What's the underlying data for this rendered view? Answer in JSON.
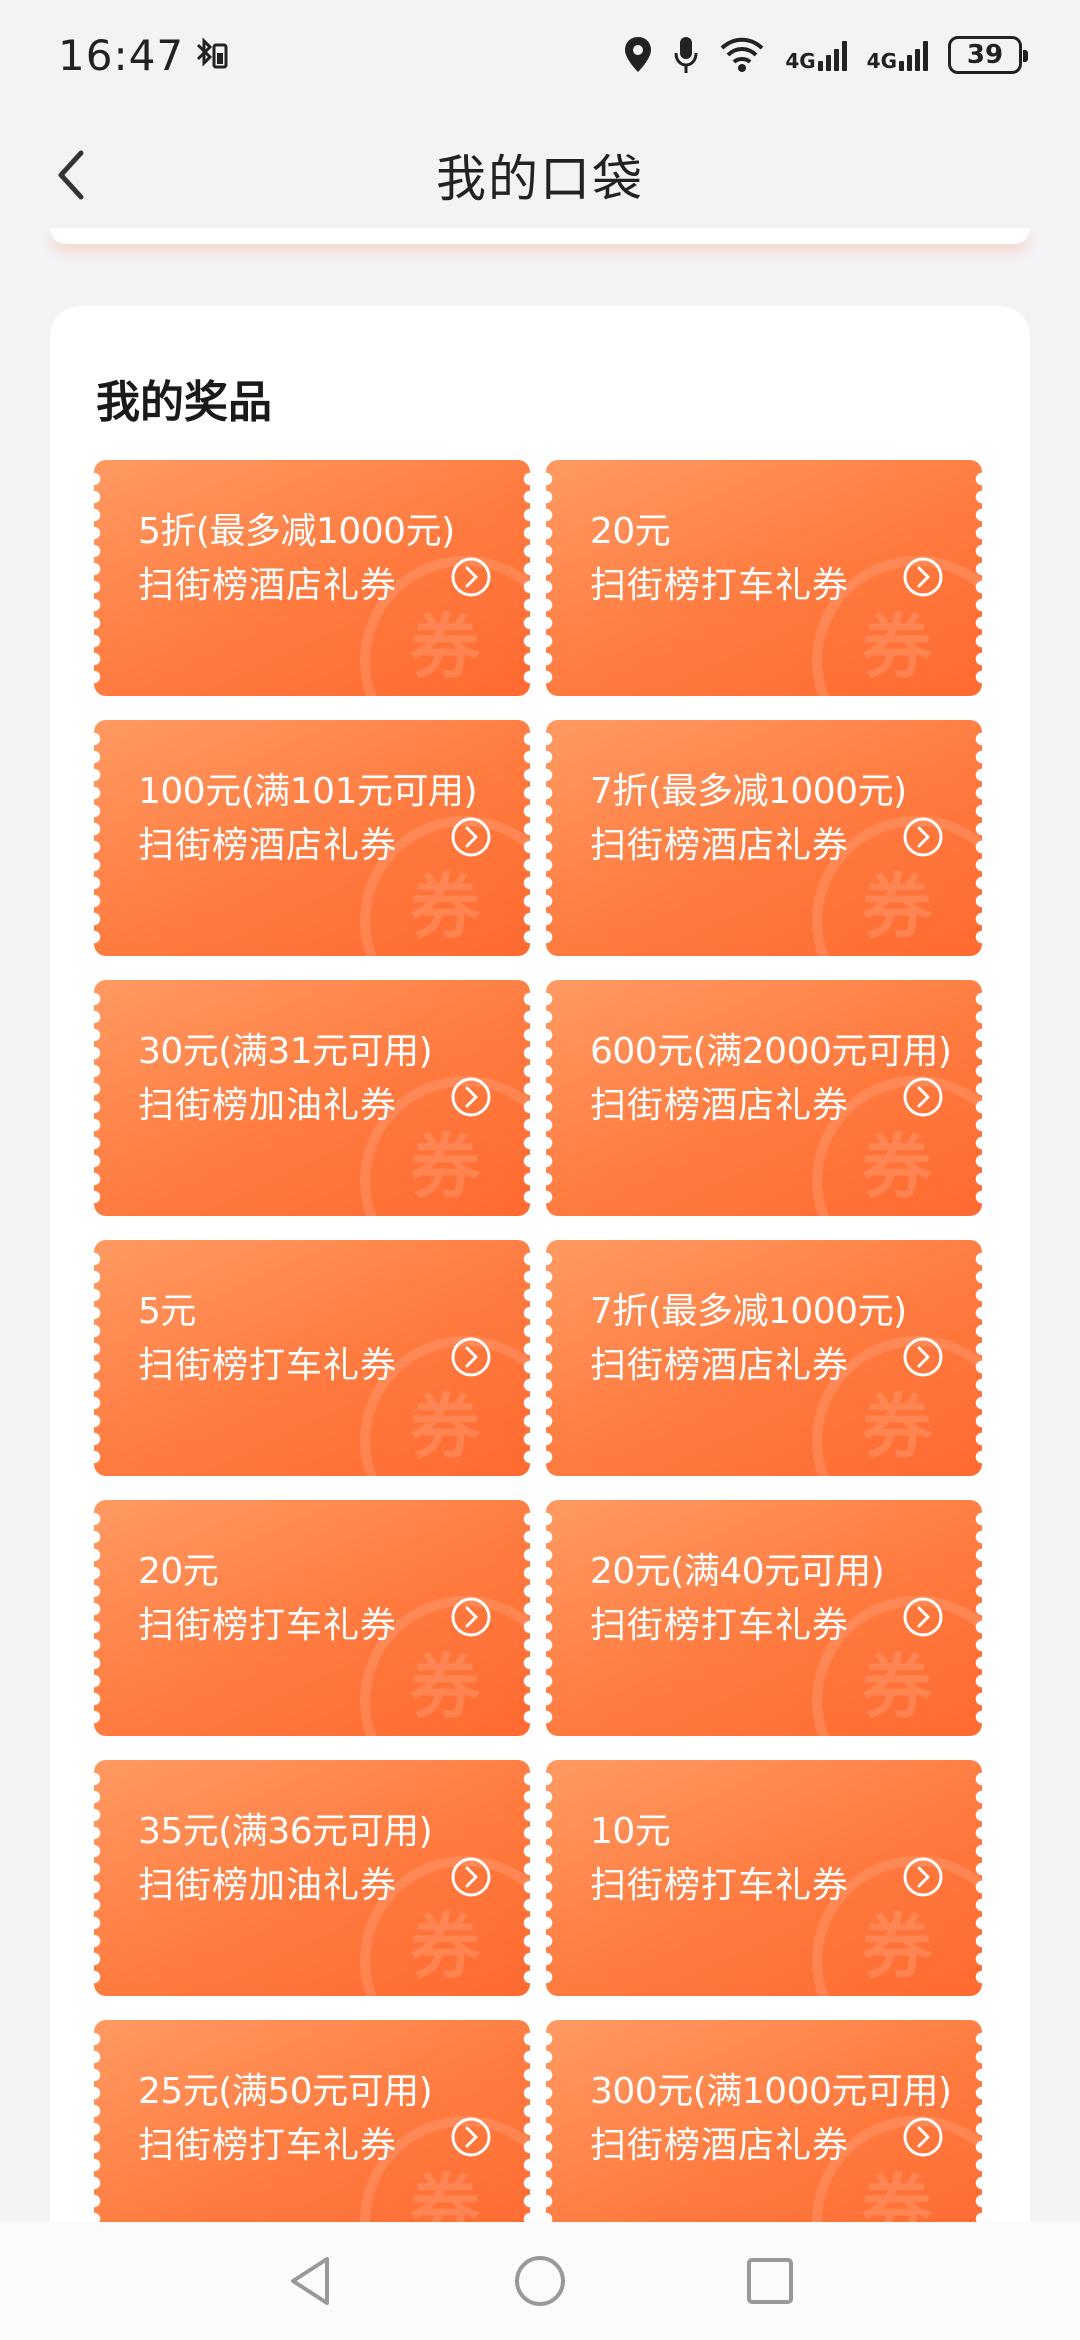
{
  "status_bar": {
    "time": "16:47",
    "network_1": "4G",
    "network_2": "4G",
    "battery": "39"
  },
  "header": {
    "title": "我的口袋"
  },
  "prizes": {
    "section_title": "我的奖品",
    "watermark": "券",
    "coupons": [
      {
        "amount": "5折(最多减1000元)",
        "name": "扫街榜酒店礼券"
      },
      {
        "amount": "20元",
        "name": "扫街榜打车礼券"
      },
      {
        "amount": "100元(满101元可用)",
        "name": "扫街榜酒店礼券"
      },
      {
        "amount": "7折(最多减1000元)",
        "name": "扫街榜酒店礼券"
      },
      {
        "amount": "30元(满31元可用)",
        "name": "扫街榜加油礼券"
      },
      {
        "amount": "600元(满2000元可用)",
        "name": "扫街榜酒店礼券"
      },
      {
        "amount": "5元",
        "name": "扫街榜打车礼券"
      },
      {
        "amount": "7折(最多减1000元)",
        "name": "扫街榜酒店礼券"
      },
      {
        "amount": "20元",
        "name": "扫街榜打车礼券"
      },
      {
        "amount": "20元(满40元可用)",
        "name": "扫街榜打车礼券"
      },
      {
        "amount": "35元(满36元可用)",
        "name": "扫街榜加油礼券"
      },
      {
        "amount": "10元",
        "name": "扫街榜打车礼券"
      },
      {
        "amount": "25元(满50元可用)",
        "name": "扫街榜打车礼券"
      },
      {
        "amount": "300元(满1000元可用)",
        "name": "扫街榜酒店礼券"
      }
    ]
  },
  "colors": {
    "coupon_start": "#ff9a62",
    "coupon_end": "#ff6a30",
    "background": "#f3f3f6"
  },
  "icons": {
    "back": "chevron-left-icon",
    "coupon_go": "chevron-right-circle-icon",
    "nav_back": "triangle-back-icon",
    "nav_home": "circle-home-icon",
    "nav_recent": "square-recent-icon"
  }
}
